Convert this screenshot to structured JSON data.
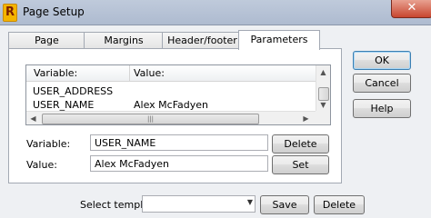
{
  "window": {
    "title": "Page Setup",
    "close_glyph": "✕",
    "app_icon_letter": "R"
  },
  "tabs": [
    {
      "label": "Page"
    },
    {
      "label": "Margins"
    },
    {
      "label": "Header/footer"
    },
    {
      "label": "Parameters",
      "active": true
    }
  ],
  "parameters": {
    "columns": {
      "variable": "Variable:",
      "value": "Value:"
    },
    "rows": [
      {
        "variable": "USER_ADDRESS",
        "value": ""
      },
      {
        "variable": "USER_NAME",
        "value": "Alex McFadyen"
      }
    ],
    "variable_label": "Variable:",
    "variable_value": "USER_NAME",
    "value_label": "Value:",
    "value_value": "Alex McFadyen",
    "delete_label": "Delete",
    "set_label": "Set"
  },
  "side_buttons": {
    "ok": "OK",
    "cancel": "Cancel",
    "help": "Help"
  },
  "footer": {
    "template_label": "Select template:",
    "template_value": "",
    "save_label": "Save",
    "delete_label": "Delete"
  }
}
